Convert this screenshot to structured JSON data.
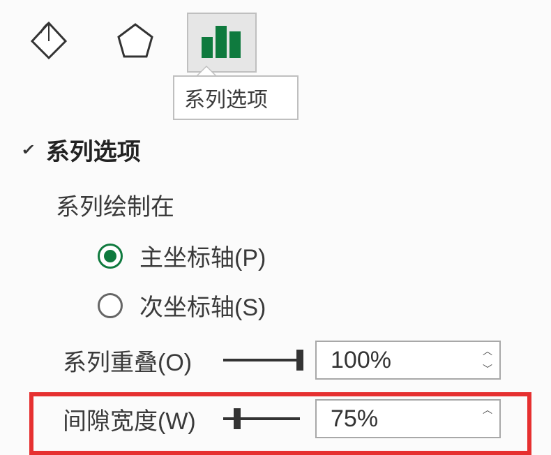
{
  "tooltip": "系列选项",
  "section": {
    "title": "系列选项",
    "plot_on": "系列绘制在",
    "radios": {
      "primary": "主坐标轴(P)",
      "secondary": "次坐标轴(S)",
      "selected": "primary"
    },
    "overlap": {
      "label": "系列重叠(O)",
      "value": "100%"
    },
    "gap": {
      "label": "间隙宽度(W)",
      "value": "75%"
    }
  }
}
